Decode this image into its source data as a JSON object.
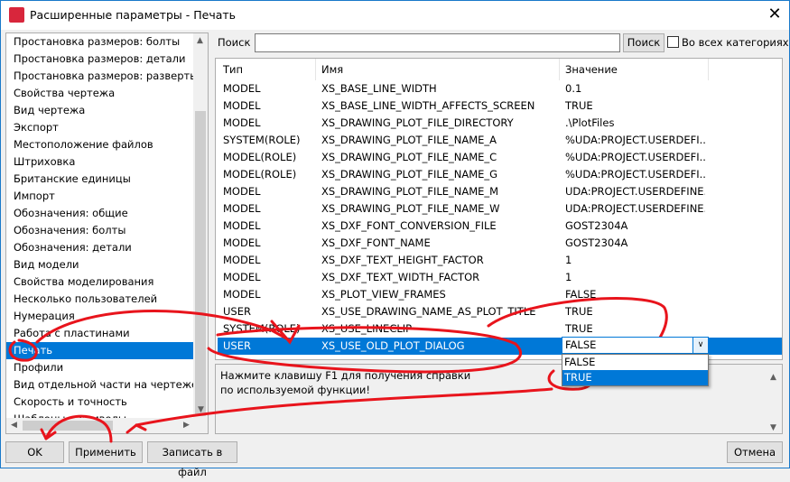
{
  "window": {
    "title": "Расширенные параметры - Печать"
  },
  "categories": [
    "Простановка размеров: болты",
    "Простановка размеров: детали",
    "Простановка размеров: развертыва",
    "Свойства чертежа",
    "Вид чертежа",
    "Экспорт",
    "Местоположение файлов",
    "Штриховка",
    "Британские единицы",
    "Импорт",
    "Обозначения: общие",
    "Обозначения: болты",
    "Обозначения: детали",
    "Вид модели",
    "Свойства моделирования",
    "Несколько пользователей",
    "Нумерация",
    "Работа с пластинами",
    "Печать",
    "Профили",
    "Вид отдельной части на чертеже сбо",
    "Скорость и точность",
    "Шаблоны и символы"
  ],
  "selected_category": "Печать",
  "search": {
    "label": "Поиск",
    "value": "",
    "button": "Поиск",
    "all_categories_label": "Во всех категориях",
    "all_categories_checked": false
  },
  "table": {
    "headers": [
      "Тип",
      "Имя",
      "Значение"
    ],
    "rows": [
      [
        "MODEL",
        "XS_BASE_LINE_WIDTH",
        "0.1"
      ],
      [
        "MODEL",
        "XS_BASE_LINE_WIDTH_AFFECTS_SCREEN",
        "TRUE"
      ],
      [
        "MODEL",
        "XS_DRAWING_PLOT_FILE_DIRECTORY",
        ".\\PlotFiles"
      ],
      [
        "SYSTEM(ROLE)",
        "XS_DRAWING_PLOT_FILE_NAME_A",
        "%UDA:PROJECT.USERDEFI..."
      ],
      [
        "MODEL(ROLE)",
        "XS_DRAWING_PLOT_FILE_NAME_C",
        "%UDA:PROJECT.USERDEFI..."
      ],
      [
        "MODEL(ROLE)",
        "XS_DRAWING_PLOT_FILE_NAME_G",
        "%UDA:PROJECT.USERDEFI..."
      ],
      [
        "MODEL",
        "XS_DRAWING_PLOT_FILE_NAME_M",
        "UDA:PROJECT.USERDEFINE..."
      ],
      [
        "MODEL",
        "XS_DRAWING_PLOT_FILE_NAME_W",
        "UDA:PROJECT.USERDEFINE..."
      ],
      [
        "MODEL",
        "XS_DXF_FONT_CONVERSION_FILE",
        "GOST2304A"
      ],
      [
        "MODEL",
        "XS_DXF_FONT_NAME",
        "GOST2304A"
      ],
      [
        "MODEL",
        "XS_DXF_TEXT_HEIGHT_FACTOR",
        "1"
      ],
      [
        "MODEL",
        "XS_DXF_TEXT_WIDTH_FACTOR",
        "1"
      ],
      [
        "MODEL",
        "XS_PLOT_VIEW_FRAMES",
        "FALSE"
      ],
      [
        "USER",
        "XS_USE_DRAWING_NAME_AS_PLOT_TITLE",
        "TRUE"
      ],
      [
        "SYSTEM(ROLE)",
        "XS_USE_LINECLIP",
        "TRUE"
      ]
    ],
    "selected_row": {
      "type": "USER",
      "name": "XS_USE_OLD_PLOT_DIALOG",
      "value": "FALSE"
    },
    "dropdown_options": [
      "FALSE",
      "TRUE"
    ],
    "highlighted_option": "TRUE"
  },
  "help": {
    "line1": "Нажмите клавишу F1 для получения справки",
    "line2": "по используемой функции!"
  },
  "buttons": {
    "ok": "OK",
    "apply": "Применить",
    "save": "Записать в файл",
    "cancel": "Отмена"
  },
  "colors": {
    "selection": "#0078d7",
    "annotation": "#e8141c"
  }
}
